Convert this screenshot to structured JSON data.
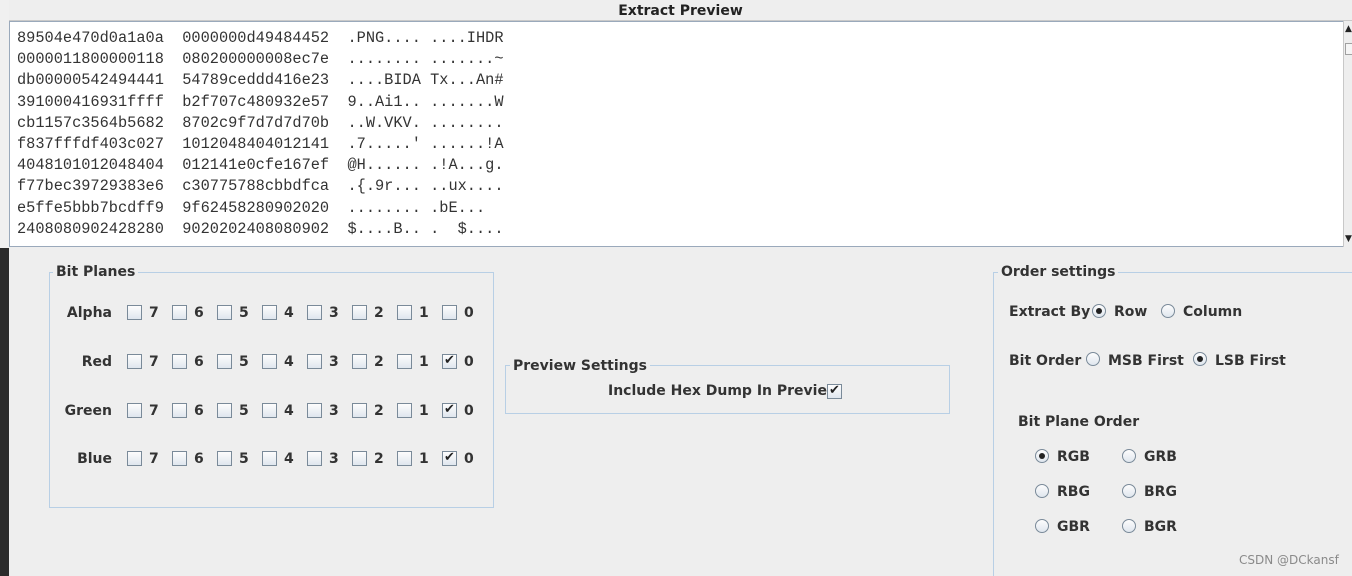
{
  "window": {
    "title": "Extract Preview"
  },
  "preview": {
    "lines": [
      "89504e470d0a1a0a  0000000d49484452  .PNG.... ....IHDR",
      "0000011800000118  080200000008ec7e  ........ .......~",
      "db00000542494441  54789ceddd416e23  ....BIDA Tx...An#",
      "391000416931ffff  b2f707c480932e57  9..Ai1.. .......W",
      "cb1157c3564b5682  8702c9f7d7d7d70b  ..W.VKV. ........",
      "f837fffdf403c027  1012048404012141  .7.....' ......!A",
      "4048101012048404  012141e0cfe167ef  @H...... .!A...g.",
      "f77bec39729383e6  c30775788cbbdfca  .{.9r... ..ux....",
      "e5ffe5bbb7bcdff9  9f62458280902020  ........ .bE...  ",
      "2408080902428280  9020202408080902  $....B.. .  $...."
    ]
  },
  "bit_planes": {
    "title": "Bit Planes",
    "bits": [
      "7",
      "6",
      "5",
      "4",
      "3",
      "2",
      "1",
      "0"
    ],
    "rows": [
      {
        "label": "Alpha",
        "checked": [
          false,
          false,
          false,
          false,
          false,
          false,
          false,
          false
        ]
      },
      {
        "label": "Red",
        "checked": [
          false,
          false,
          false,
          false,
          false,
          false,
          false,
          true
        ]
      },
      {
        "label": "Green",
        "checked": [
          false,
          false,
          false,
          false,
          false,
          false,
          false,
          true
        ]
      },
      {
        "label": "Blue",
        "checked": [
          false,
          false,
          false,
          false,
          false,
          false,
          false,
          true
        ]
      }
    ]
  },
  "preview_settings": {
    "title": "Preview Settings",
    "include_hex_label": "Include Hex Dump In Preview",
    "include_hex_checked": true
  },
  "order_settings": {
    "title": "Order settings",
    "extract_by_label": "Extract By",
    "extract_by_options": [
      "Row",
      "Column"
    ],
    "extract_by_selected": "Row",
    "bit_order_label": "Bit Order",
    "bit_order_options": [
      "MSB First",
      "LSB First"
    ],
    "bit_order_selected": "LSB First",
    "plane_order_label": "Bit Plane Order",
    "plane_order_options": [
      "RGB",
      "GRB",
      "RBG",
      "BRG",
      "GBR",
      "BGR"
    ],
    "plane_order_selected": "RGB"
  },
  "watermark": "CSDN @DCkansf"
}
